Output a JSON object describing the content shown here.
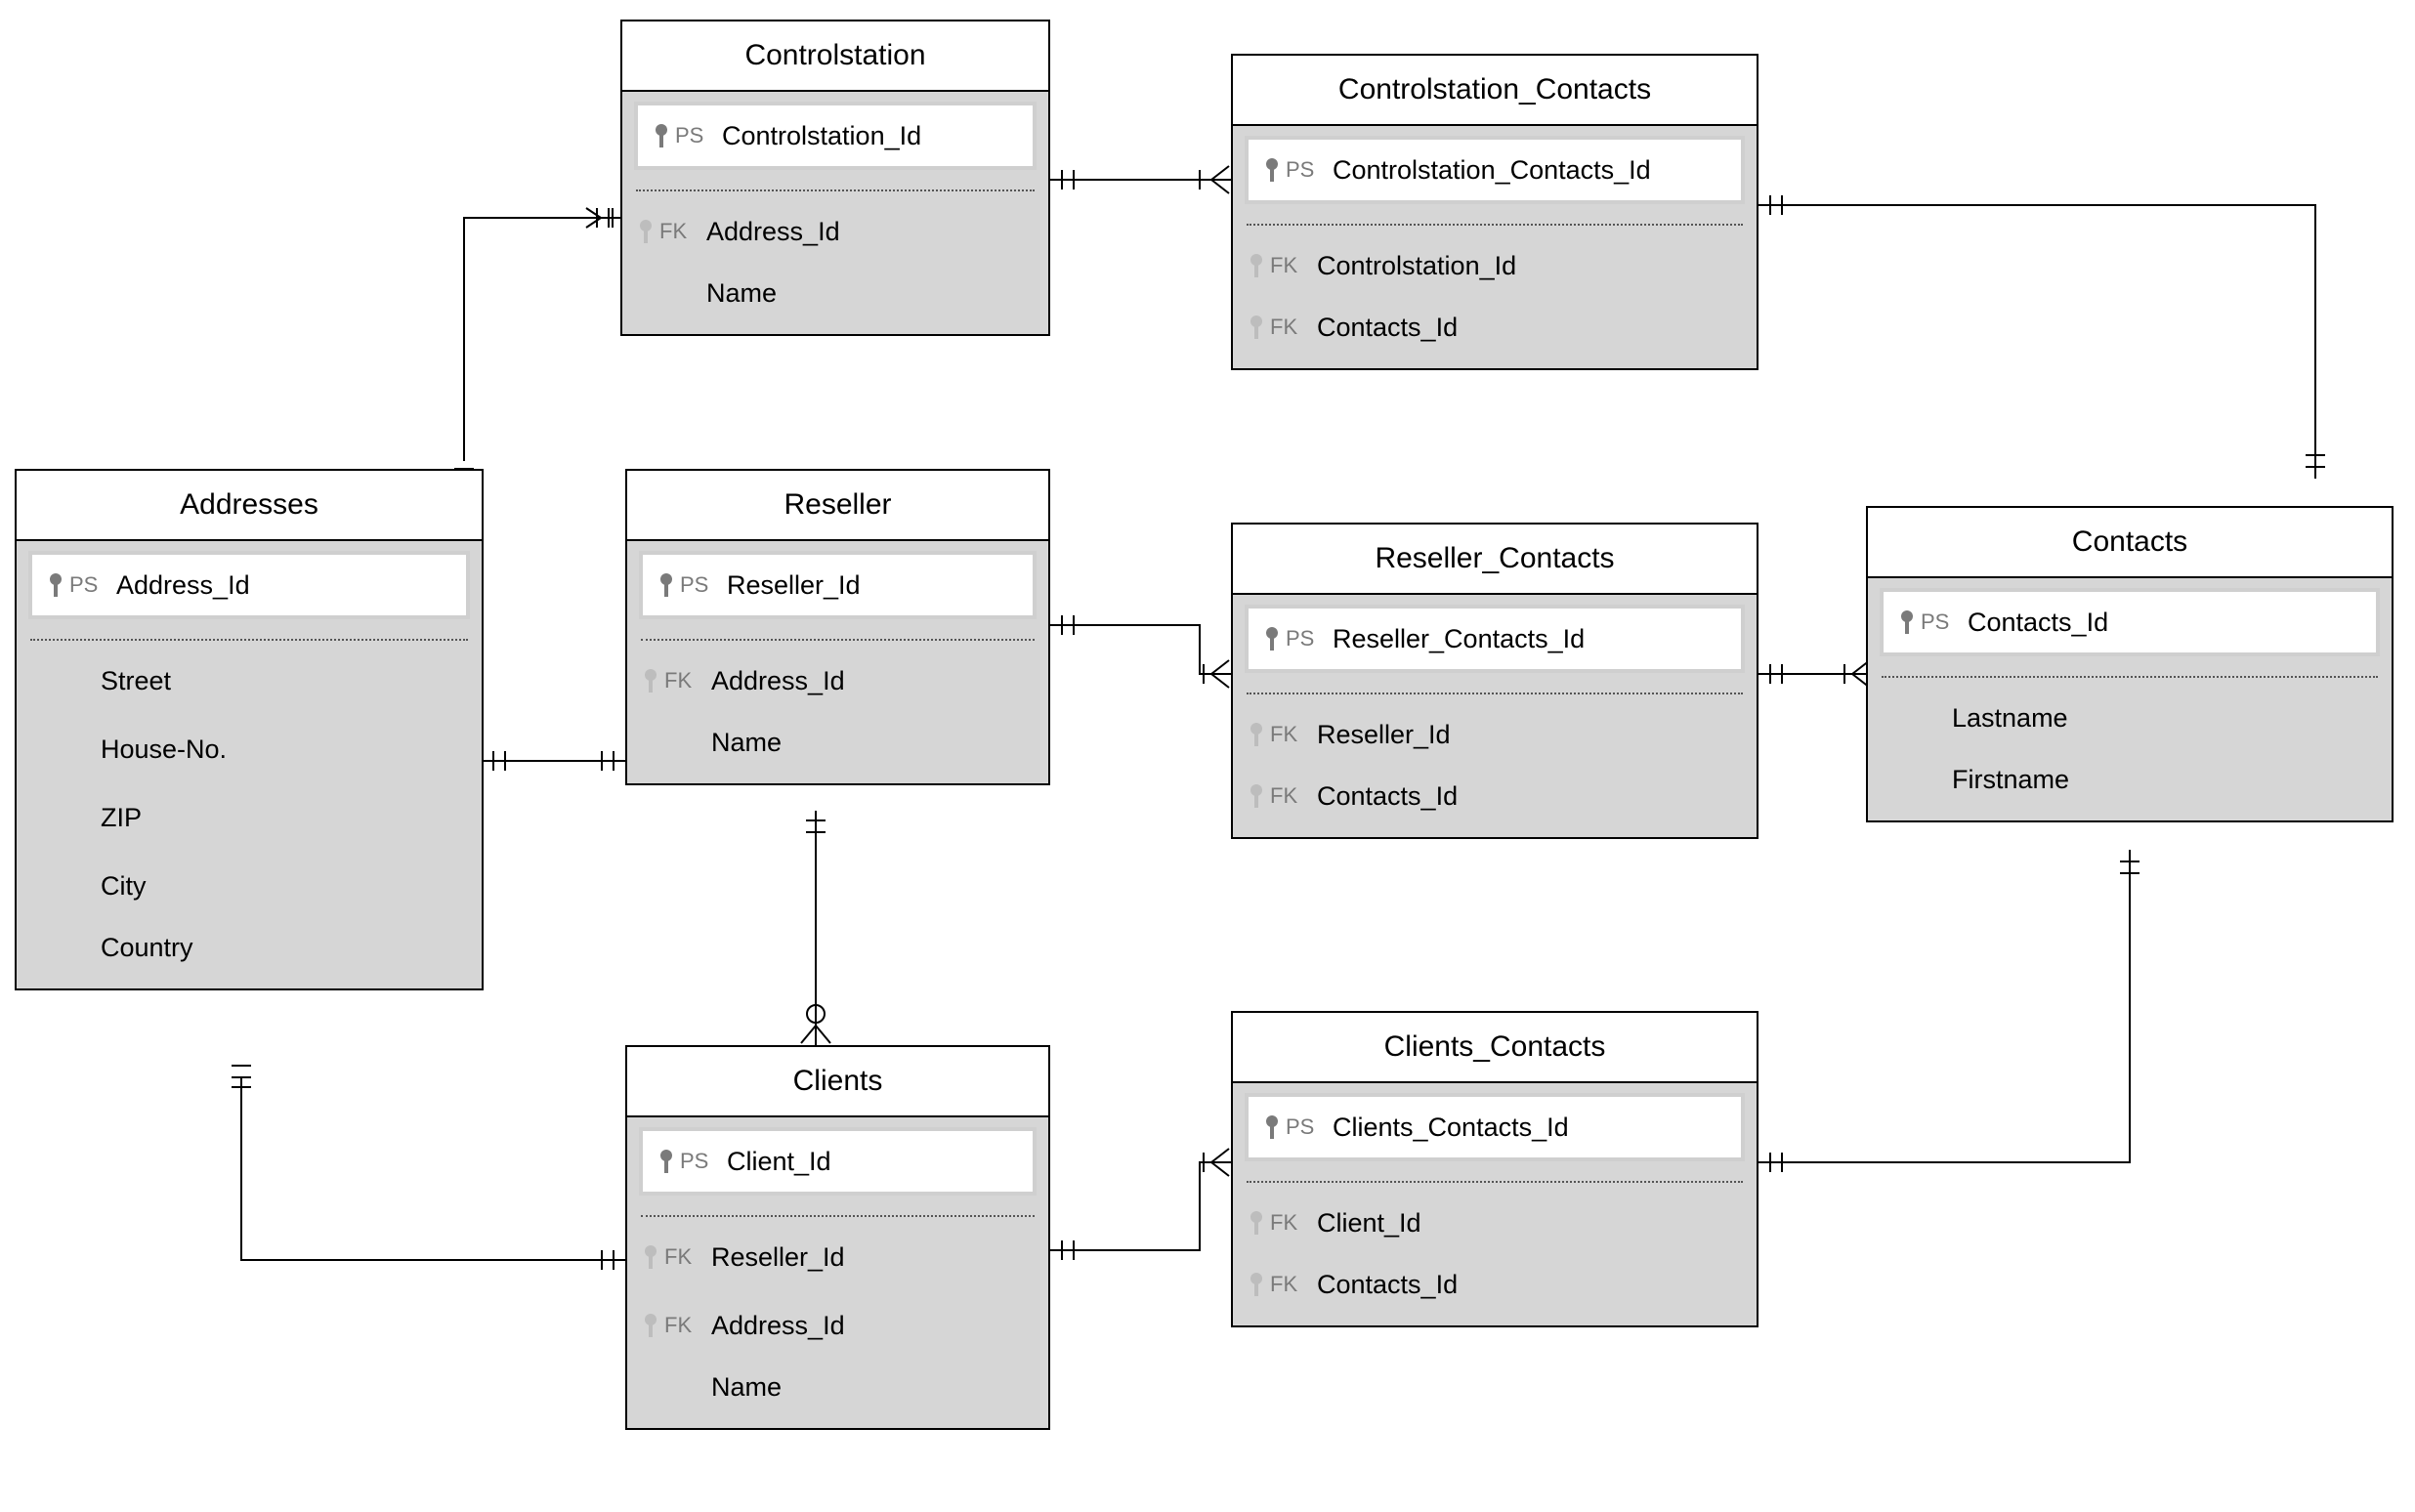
{
  "entities": {
    "addresses": {
      "title": "Addresses",
      "pk_tag": "PS",
      "pk": "Address_Id",
      "cols": [
        "Street",
        "House-No.",
        "ZIP",
        "City",
        "Country"
      ]
    },
    "controlstation": {
      "title": "Controlstation",
      "pk_tag": "PS",
      "pk": "Controlstation_Id",
      "fk_tag": "FK",
      "fks": [
        "Address_Id"
      ],
      "cols": [
        "Name"
      ]
    },
    "reseller": {
      "title": "Reseller",
      "pk_tag": "PS",
      "pk": "Reseller_Id",
      "fk_tag": "FK",
      "fks": [
        "Address_Id"
      ],
      "cols": [
        "Name"
      ]
    },
    "clients": {
      "title": "Clients",
      "pk_tag": "PS",
      "pk": "Client_Id",
      "fk_tag": "FK",
      "fks": [
        "Reseller_Id",
        "Address_Id"
      ],
      "cols": [
        "Name"
      ]
    },
    "controlstation_contacts": {
      "title": "Controlstation_Contacts",
      "pk_tag": "PS",
      "pk": "Controlstation_Contacts_Id",
      "fk_tag": "FK",
      "fks": [
        "Controlstation_Id",
        "Contacts_Id"
      ]
    },
    "reseller_contacts": {
      "title": "Reseller_Contacts",
      "pk_tag": "PS",
      "pk": "Reseller_Contacts_Id",
      "fk_tag": "FK",
      "fks": [
        "Reseller_Id",
        "Contacts_Id"
      ]
    },
    "clients_contacts": {
      "title": "Clients_Contacts",
      "pk_tag": "PS",
      "pk": "Clients_Contacts_Id",
      "fk_tag": "FK",
      "fks": [
        "Client_Id",
        "Contacts_Id"
      ]
    },
    "contacts": {
      "title": "Contacts",
      "pk_tag": "PS",
      "pk": "Contacts_Id",
      "cols": [
        "Lastname",
        "Firstname"
      ]
    }
  }
}
